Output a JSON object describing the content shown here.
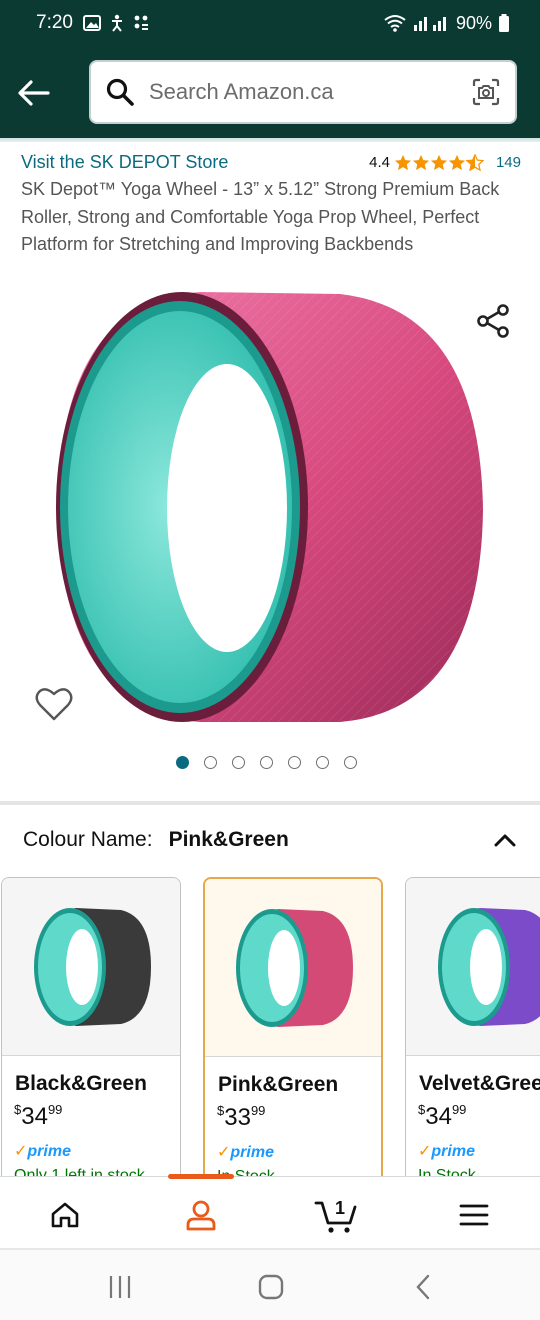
{
  "status_bar": {
    "time": "7:20",
    "battery": "90%",
    "icons": [
      "image-icon",
      "accessibility-icon",
      "dots-icon",
      "wifi-icon",
      "signal-icon",
      "battery-icon"
    ]
  },
  "header": {
    "search_placeholder": "Search Amazon.ca",
    "background": "#0b3a33"
  },
  "product": {
    "store_link": "Visit the SK DEPOT Store",
    "rating": "4.4",
    "rating_count": "149",
    "rating_fraction": 0.88,
    "title": "SK Depot™ Yoga Wheel - 13” x 5.12” Strong Premium Back Roller, Strong and Comfortable Yoga Prop Wheel, Perfect Platform for Stretching and Improving Backbends",
    "image_count": 7,
    "active_image": 0
  },
  "colour": {
    "label": "Colour Name:",
    "selected": "Pink&Green"
  },
  "variants": [
    {
      "name": "Black&Green",
      "price_dollars": "34",
      "price_cents": "99",
      "currency": "$",
      "prime": "prime",
      "stock": "Only 1 left in stock",
      "ring_color": "#3a3a3a",
      "selected": false
    },
    {
      "name": "Pink&Green",
      "price_dollars": "33",
      "price_cents": "99",
      "currency": "$",
      "prime": "prime",
      "stock": "In Stock",
      "ring_color": "#d44a77",
      "selected": true
    },
    {
      "name": "Velvet&Green",
      "price_dollars": "34",
      "price_cents": "99",
      "currency": "$",
      "prime": "prime",
      "stock": "In Stock",
      "ring_color": "#7b4bc9",
      "selected": false
    }
  ],
  "bottom_nav": {
    "items": [
      "home-icon",
      "account-icon",
      "cart-icon",
      "menu-icon"
    ],
    "cart_count": "1",
    "active": "account-icon",
    "accent": "#ea5a1a"
  },
  "colors": {
    "link": "#0a6b80",
    "star": "#f79400",
    "prime": "#1a98ff"
  }
}
